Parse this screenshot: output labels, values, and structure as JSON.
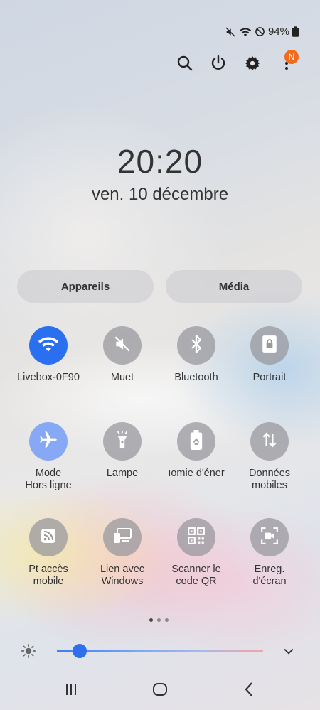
{
  "status_bar": {
    "icons": [
      "mute-icon",
      "wifi-icon",
      "do-not-disturb-icon",
      "battery-icon"
    ],
    "battery": "94%"
  },
  "top_actions": {
    "icons": [
      "search-icon",
      "power-icon",
      "settings-gear-icon",
      "more-vertical-icon"
    ],
    "notification_badge": "N"
  },
  "clock": {
    "time": "20:20",
    "date": "ven. 10 décembre"
  },
  "pills": {
    "devices": "Appareils",
    "media": "Média"
  },
  "tiles": [
    {
      "label": "Livebox-0F90",
      "icon": "wifi-icon",
      "state": "on"
    },
    {
      "label": "Muet",
      "icon": "mute-icon",
      "state": "off"
    },
    {
      "label": "Bluetooth",
      "icon": "bluetooth-icon",
      "state": "off"
    },
    {
      "label": "Portrait",
      "icon": "portrait-lock-icon",
      "state": "off"
    },
    {
      "label_line1": "Mode",
      "label_line2": "Hors ligne",
      "icon": "airplane-icon",
      "state": "on-soft"
    },
    {
      "label": "Lampe",
      "icon": "flashlight-icon",
      "state": "off"
    },
    {
      "label": "ıomie d'éner",
      "icon": "battery-saver-icon",
      "state": "off"
    },
    {
      "label_line1": "Données",
      "label_line2": "mobiles",
      "icon": "mobile-data-icon",
      "state": "off"
    },
    {
      "label_line1": "Pt accès",
      "label_line2": "mobile",
      "icon": "hotspot-icon",
      "state": "off"
    },
    {
      "label_line1": "Lien avec",
      "label_line2": "Windows",
      "icon": "link-windows-icon",
      "state": "off"
    },
    {
      "label_line1": "Scanner le",
      "label_line2": "code QR",
      "icon": "qr-code-icon",
      "state": "off"
    },
    {
      "label_line1": "Enreg.",
      "label_line2": "d'écran",
      "icon": "screen-record-icon",
      "state": "off"
    }
  ],
  "page_indicator": {
    "pages": 3,
    "current": 1
  },
  "brightness": {
    "level": 0.11
  },
  "colors": {
    "accent": "#2a6ff0",
    "badge": "#f26b1d"
  }
}
